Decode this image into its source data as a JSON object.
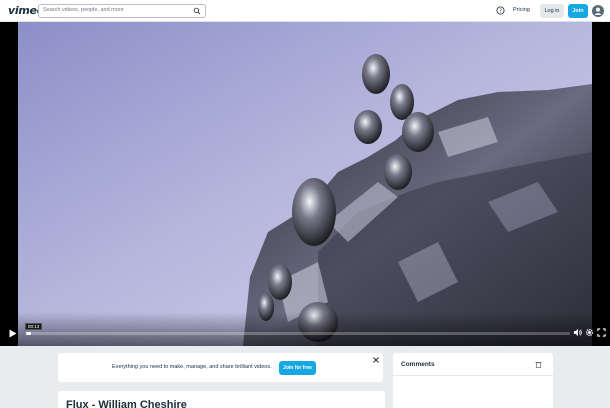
{
  "header": {
    "logo": "vimeo",
    "search_placeholder": "Search videos, people, and more",
    "pricing": "Pricing",
    "login": "Log in",
    "join": "Join"
  },
  "player": {
    "time": "00:13",
    "progress_fraction": 0.01
  },
  "promo": {
    "text": "Everything you need to make, manage, and share brilliant videos.",
    "button": "Join for free"
  },
  "comments": {
    "title": "Comments"
  },
  "video": {
    "title": "Flux - William Cheshire"
  },
  "colors": {
    "accent": "#17a8e3",
    "text_dark": "#1a2e3b",
    "page_bg": "#e9ecef"
  }
}
